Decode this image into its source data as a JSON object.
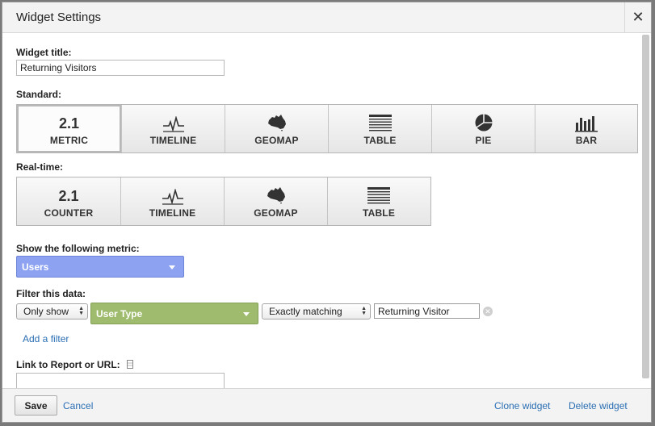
{
  "dialog": {
    "title": "Widget Settings",
    "close_label": "✕"
  },
  "widget_title": {
    "label": "Widget title:",
    "value": "Returning Visitors"
  },
  "standard": {
    "label": "Standard:",
    "tiles": [
      {
        "label": "METRIC",
        "icon": "2.1",
        "selected": true
      },
      {
        "label": "TIMELINE",
        "icon": "timeline-icon"
      },
      {
        "label": "GEOMAP",
        "icon": "geomap-icon"
      },
      {
        "label": "TABLE",
        "icon": "table-icon"
      },
      {
        "label": "PIE",
        "icon": "pie-icon"
      },
      {
        "label": "BAR",
        "icon": "bar-icon"
      }
    ]
  },
  "realtime": {
    "label": "Real-time:",
    "tiles": [
      {
        "label": "COUNTER",
        "icon": "2.1"
      },
      {
        "label": "TIMELINE",
        "icon": "timeline-icon"
      },
      {
        "label": "GEOMAP",
        "icon": "geomap-icon"
      },
      {
        "label": "TABLE",
        "icon": "table-icon"
      }
    ]
  },
  "metric": {
    "label": "Show the following metric:",
    "value": "Users",
    "color": "#8da2f0"
  },
  "filter": {
    "label": "Filter this data:",
    "mode": "Only show",
    "dimension": "User Type",
    "dimension_color": "#9fbc6e",
    "match": "Exactly matching",
    "value": "Returning Visitor",
    "add_filter": "Add a filter"
  },
  "link": {
    "label": "Link to Report or URL:",
    "value": ""
  },
  "footer": {
    "save": "Save",
    "cancel": "Cancel",
    "clone": "Clone widget",
    "delete": "Delete widget"
  },
  "colors": {
    "link": "#2a6eb3"
  }
}
